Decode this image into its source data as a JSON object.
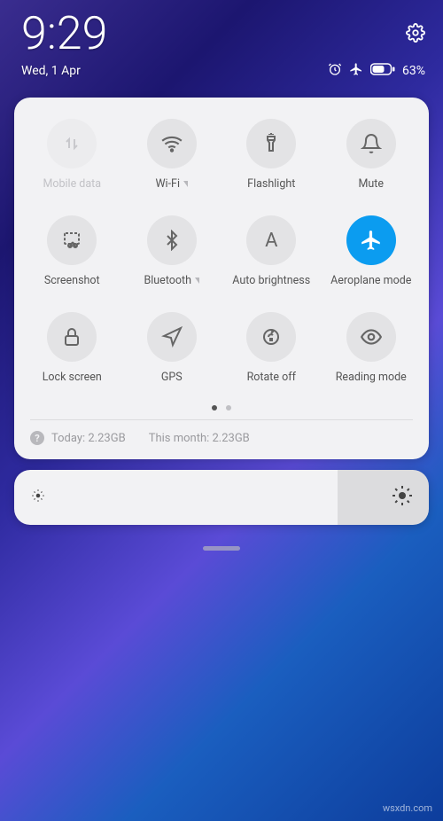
{
  "status": {
    "time": "9:29",
    "date": "Wed, 1 Apr",
    "battery": "63%"
  },
  "tiles": [
    {
      "label": "Mobile data"
    },
    {
      "label": "Wi-Fi"
    },
    {
      "label": "Flashlight"
    },
    {
      "label": "Mute"
    },
    {
      "label": "Screenshot"
    },
    {
      "label": "Bluetooth"
    },
    {
      "label": "Auto brightness"
    },
    {
      "label": "Aeroplane mode"
    },
    {
      "label": "Lock screen"
    },
    {
      "label": "GPS"
    },
    {
      "label": "Rotate off"
    },
    {
      "label": "Reading mode"
    }
  ],
  "data_usage": {
    "today": "Today: 2.23GB",
    "month": "This month: 2.23GB"
  },
  "watermark": "wsxdn.com"
}
